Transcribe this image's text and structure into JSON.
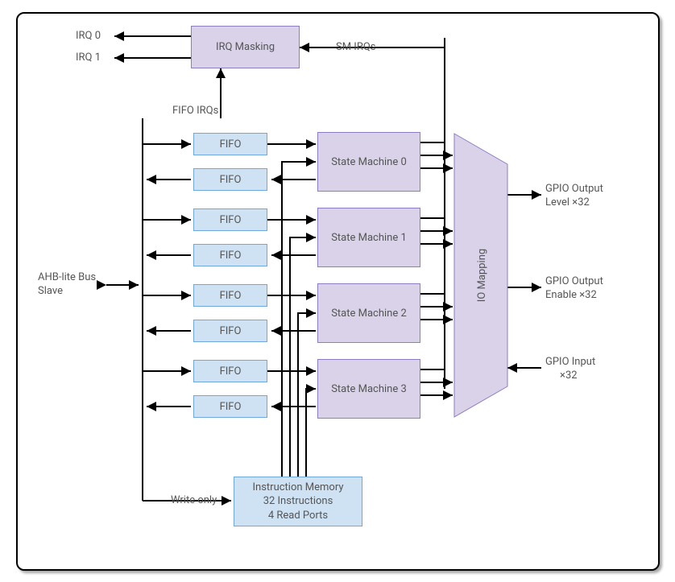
{
  "blocks": {
    "irq_masking": "IRQ Masking",
    "fifo": "FIFO",
    "sm0": "State Machine 0",
    "sm1": "State Machine 1",
    "sm2": "State Machine 2",
    "sm3": "State Machine 3",
    "io_mapping": "IO Mapping",
    "instr_mem_l1": "Instruction Memory",
    "instr_mem_l2": "32 Instructions",
    "instr_mem_l3": "4 Read Ports"
  },
  "labels": {
    "irq0": "IRQ 0",
    "irq1": "IRQ 1",
    "sm_irqs": "SM IRQs",
    "fifo_irqs": "FIFO IRQs",
    "ahb_l1": "AHB-lite Bus",
    "ahb_l2": "Slave",
    "write_only": "Write only",
    "gpio_out_level_l1": "GPIO Output",
    "gpio_out_level_l2": "Level ×32",
    "gpio_out_enable_l1": "GPIO Output",
    "gpio_out_enable_l2": "Enable ×32",
    "gpio_input_l1": "GPIO Input",
    "gpio_input_l2": "×32"
  }
}
